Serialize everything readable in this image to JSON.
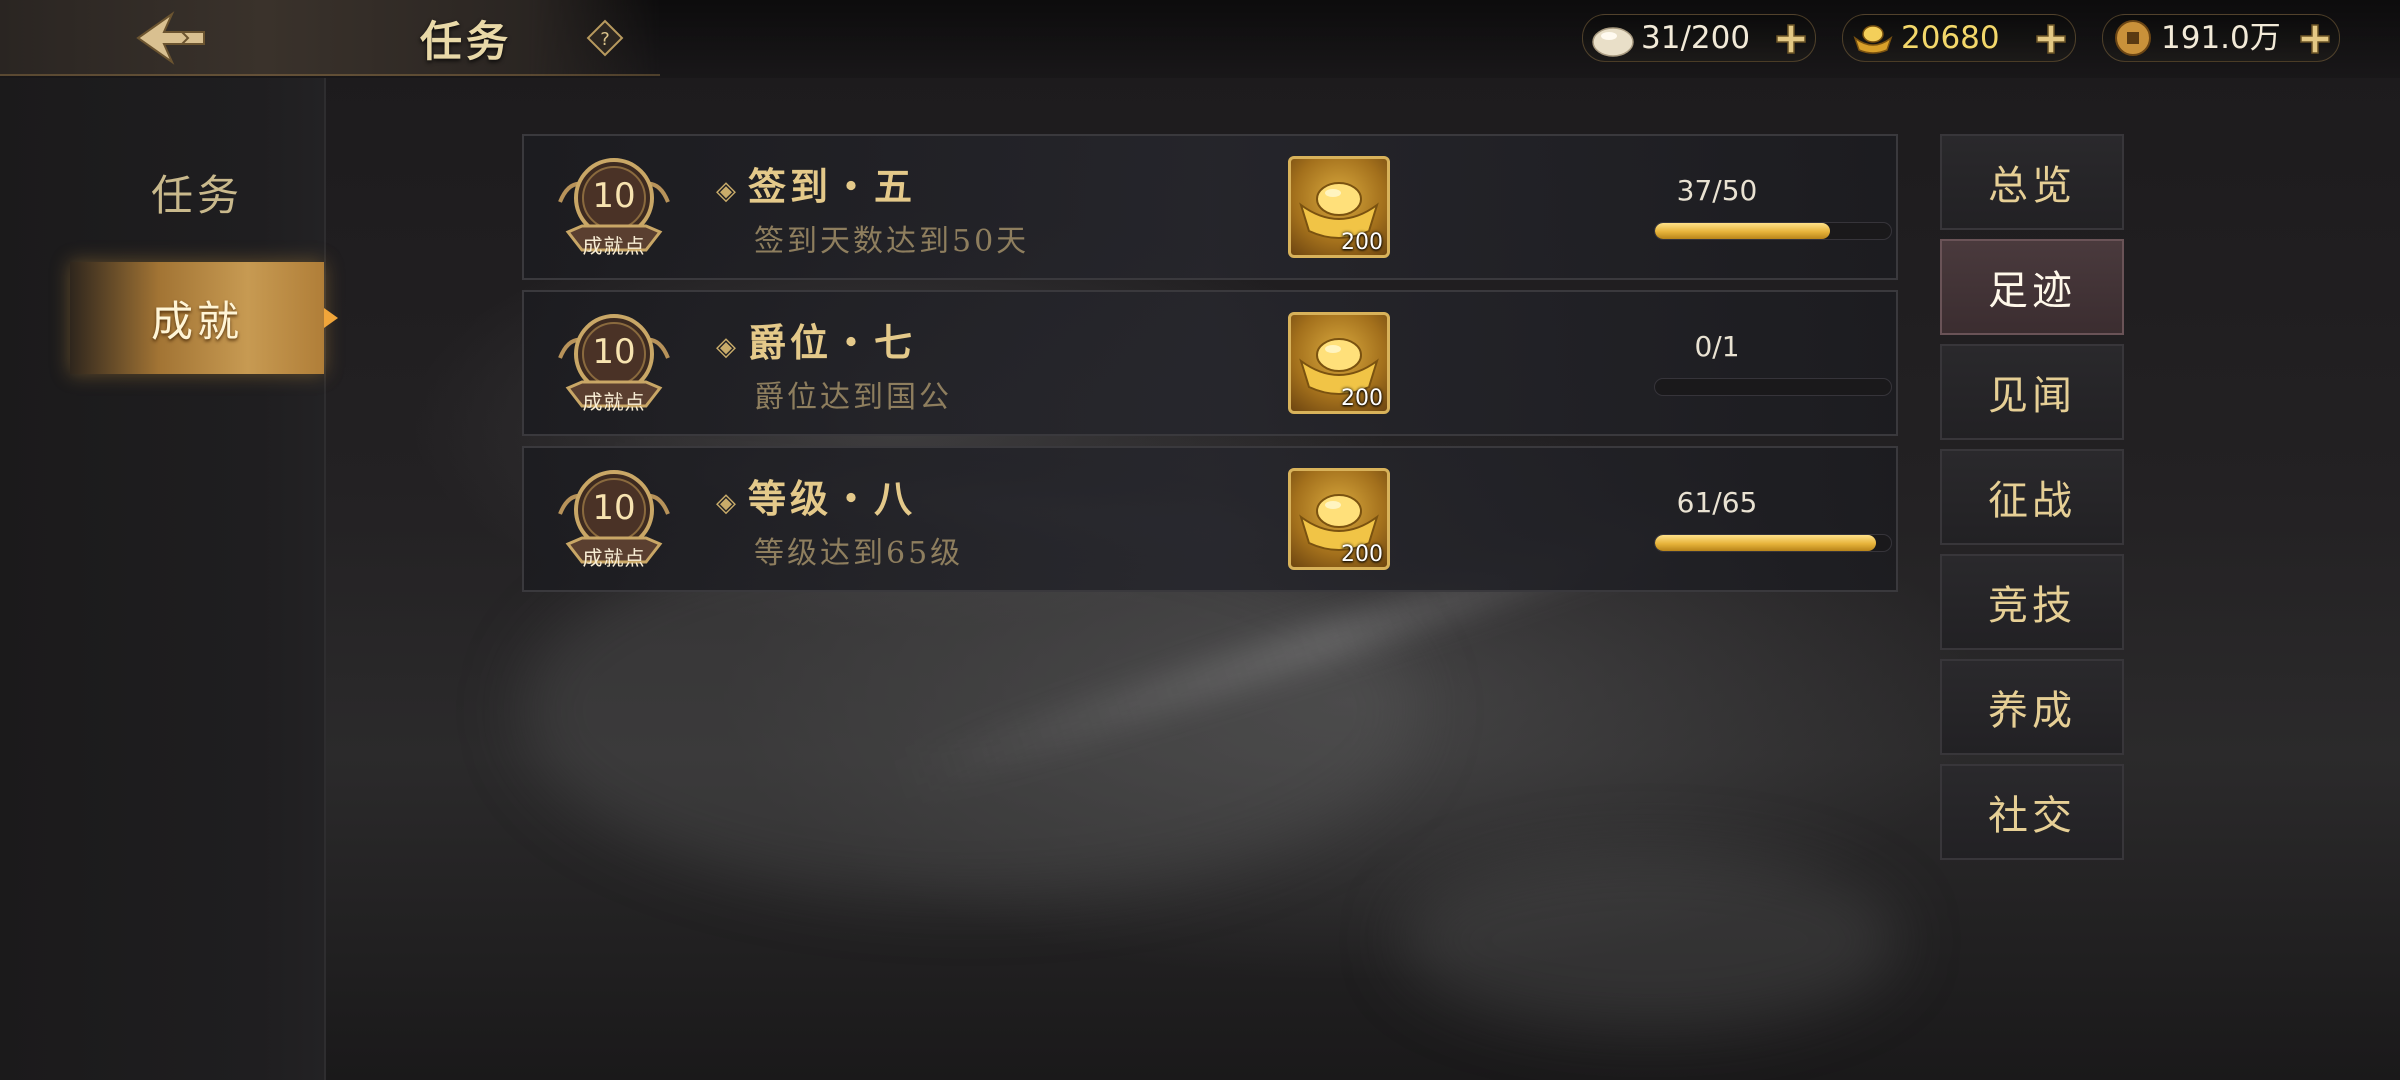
{
  "header": {
    "title": "任务",
    "back_icon": "back-arrow-icon",
    "help_icon": "help-question-icon"
  },
  "currencies": [
    {
      "name": "steamed-bun",
      "icon": "bun-icon",
      "value": "31/200",
      "color": "#f2ead8"
    },
    {
      "name": "gold-ingot",
      "icon": "gold-ingot-icon",
      "value": "20680",
      "color": "#f3d76a"
    },
    {
      "name": "copper-coin",
      "icon": "coin-icon",
      "value": "191.0万",
      "color": "#f2ead8"
    }
  ],
  "sidebar": {
    "tabs": [
      {
        "label": "任务",
        "active": false
      },
      {
        "label": "成就",
        "active": true
      }
    ]
  },
  "achievements": [
    {
      "points": "10",
      "points_label": "成就点",
      "title": "签到・五",
      "desc": "签到天数达到50天",
      "reward_icon": "gold-ingot-icon",
      "reward_count": "200",
      "progress_text": "37/50",
      "progress": 0.74
    },
    {
      "points": "10",
      "points_label": "成就点",
      "title": "爵位・七",
      "desc": "爵位达到国公",
      "reward_icon": "gold-ingot-icon",
      "reward_count": "200",
      "progress_text": "0/1",
      "progress": 0.0
    },
    {
      "points": "10",
      "points_label": "成就点",
      "title": "等级・八",
      "desc": "等级达到65级",
      "reward_icon": "gold-ingot-icon",
      "reward_count": "200",
      "progress_text": "61/65",
      "progress": 0.938
    }
  ],
  "categories": [
    {
      "label": "总览",
      "active": false
    },
    {
      "label": "足迹",
      "active": true
    },
    {
      "label": "见闻",
      "active": false
    },
    {
      "label": "征战",
      "active": false
    },
    {
      "label": "竞技",
      "active": false
    },
    {
      "label": "养成",
      "active": false
    },
    {
      "label": "社交",
      "active": false
    }
  ],
  "colors": {
    "accent_gold": "#e4c98a",
    "progress_fill": "#e6b33a",
    "active_tab": "#c79a52"
  }
}
